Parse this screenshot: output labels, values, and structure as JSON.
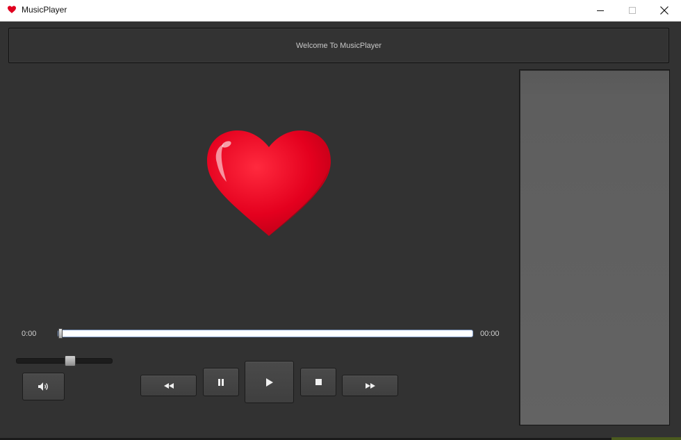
{
  "window": {
    "title": "MusicPlayer",
    "app_icon": "heart-icon",
    "controls": {
      "minimize_icon": "minimize-icon",
      "maximize_icon": "maximize-icon",
      "close_icon": "close-icon"
    }
  },
  "banner": {
    "text": "Welcome To MusicPlayer"
  },
  "album_art": {
    "icon": "heart-icon",
    "color": "#e0001f"
  },
  "playback": {
    "current_time": "0:00",
    "total_time": "00:00",
    "progress_fraction": 0.0
  },
  "volume": {
    "level_fraction": 0.5,
    "icon": "speaker-icon"
  },
  "controls": {
    "rewind_icon": "rewind-icon",
    "pause_icon": "pause-icon",
    "play_icon": "play-icon",
    "stop_icon": "stop-icon",
    "forward_icon": "fast-forward-icon"
  },
  "colors": {
    "background": "#323232",
    "accent_heart": "#e0001f",
    "playlist_bg": "#5e5e5e"
  }
}
